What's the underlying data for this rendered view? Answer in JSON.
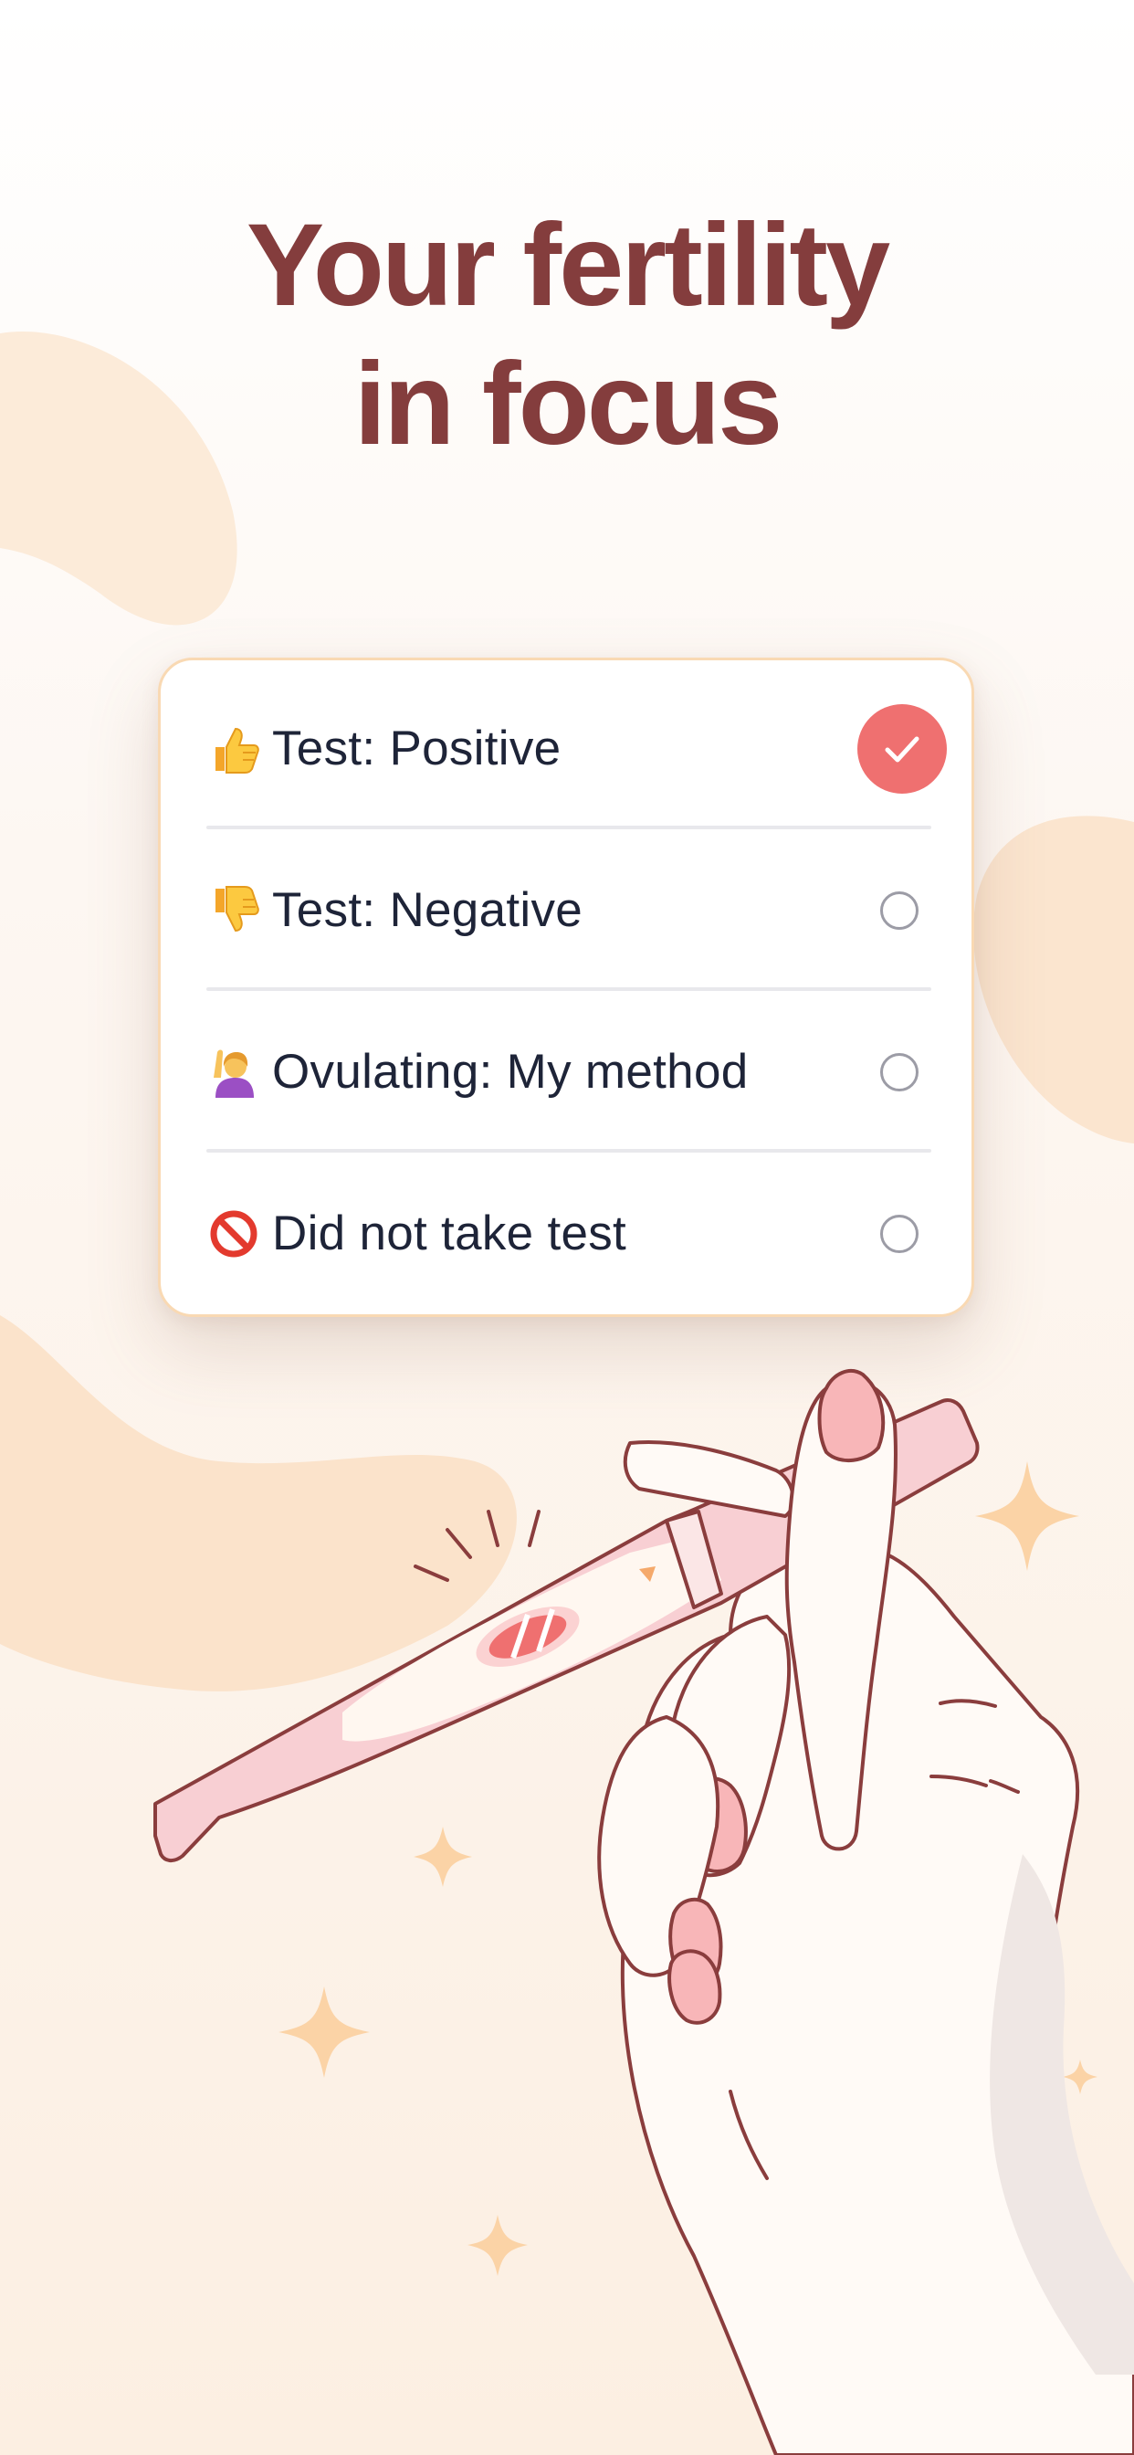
{
  "headline": {
    "line1": "Your fertility",
    "line2": "in focus"
  },
  "options": [
    {
      "icon": "thumbs-up-icon",
      "label": "Test: Positive",
      "selected": true
    },
    {
      "icon": "thumbs-down-icon",
      "label": "Test: Negative",
      "selected": false
    },
    {
      "icon": "raising-hand-woman-icon",
      "label": "Ovulating: My method",
      "selected": false
    },
    {
      "icon": "prohibited-icon",
      "label": "Did not take test",
      "selected": false
    }
  ],
  "colors": {
    "headline": "#843d3d",
    "background": "#fdf6f0",
    "accent": "#ef7070",
    "card_border": "#f9d9b3",
    "blob": "#fbe3cb"
  }
}
